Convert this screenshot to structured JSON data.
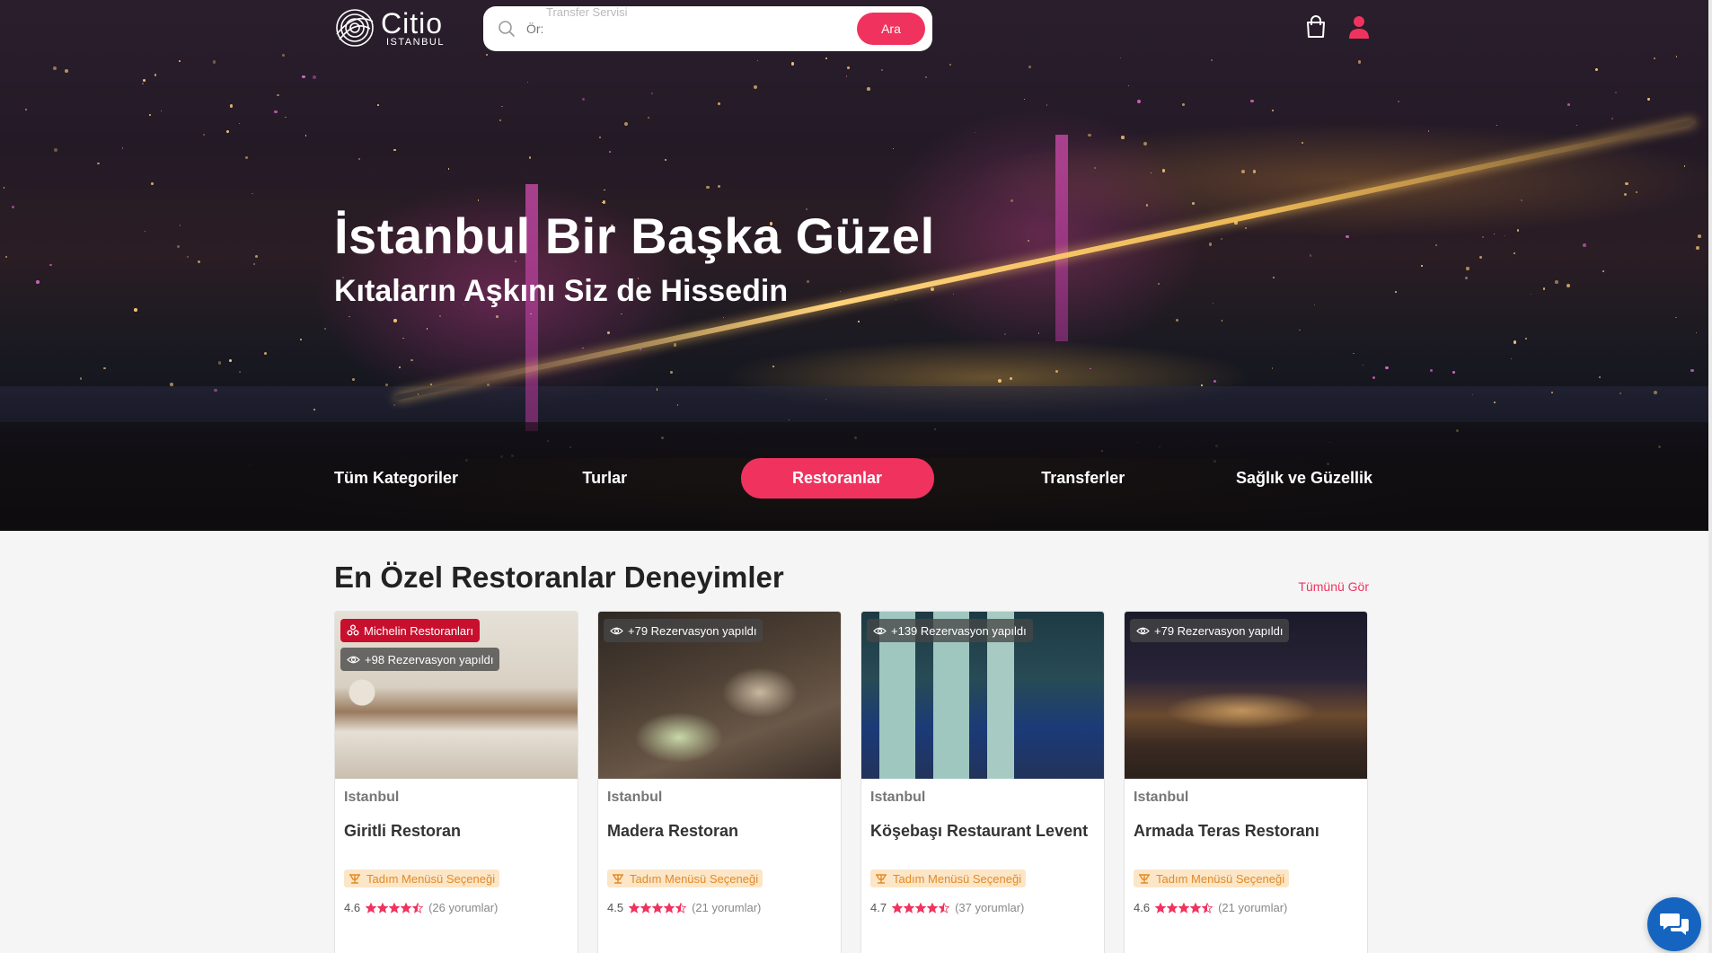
{
  "header": {
    "logo_name": "Citio",
    "logo_sub": "ISTANBUL",
    "search_placeholder": "Ör:",
    "search_hint": "Transfer Servisi",
    "search_button": "Ara"
  },
  "hero": {
    "title": "İstanbul Bir Başka Güzel",
    "subtitle": "Kıtaların Aşkını Siz de Hissedin"
  },
  "categories": [
    {
      "label": "Tüm Kategoriler",
      "active": false
    },
    {
      "label": "Turlar",
      "active": false
    },
    {
      "label": "Restoranlar",
      "active": true
    },
    {
      "label": "Transferler",
      "active": false
    },
    {
      "label": "Sağlık ve Güzellik",
      "active": false
    }
  ],
  "section": {
    "title": "En Özel Restoranlar Deneyimler",
    "see_all": "Tümünü Gör"
  },
  "cards": [
    {
      "michelin": "Michelin Restoranları",
      "reservations": "+98 Rezervasyon yapıldı",
      "city": "Istanbul",
      "name": "Giritli Restoran",
      "tag": "Tadım Menüsü Seçeneği",
      "rating": "4.6",
      "reviews": "(26 yorumlar)",
      "stars": 4.5
    },
    {
      "reservations": "+79 Rezervasyon yapıldı",
      "city": "Istanbul",
      "name": "Madera Restoran",
      "tag": "Tadım Menüsü Seçeneği",
      "rating": "4.5",
      "reviews": "(21 yorumlar)",
      "stars": 4.5
    },
    {
      "reservations": "+139 Rezervasyon yapıldı",
      "city": "Istanbul",
      "name": "Köşebaşı Restaurant Levent",
      "tag": "Tadım Menüsü Seçeneği",
      "rating": "4.7",
      "reviews": "(37 yorumlar)",
      "stars": 4.5
    },
    {
      "reservations": "+79 Rezervasyon yapıldı",
      "city": "Istanbul",
      "name": "Armada Teras Restoranı",
      "tag": "Tadım Menüsü Seçeneği",
      "rating": "4.6",
      "reviews": "(21 yorumlar)",
      "stars": 4.5
    }
  ],
  "colors": {
    "accent": "#f0335e",
    "michelin": "#c8102e",
    "tag_bg": "#fbe6c8",
    "tag_text": "#e48a25",
    "chat": "#1565c0"
  },
  "icons": [
    "search-icon",
    "cart-icon",
    "user-icon",
    "michelin-icon",
    "eye-icon",
    "dining-icon",
    "star-icon",
    "chat-icon"
  ]
}
